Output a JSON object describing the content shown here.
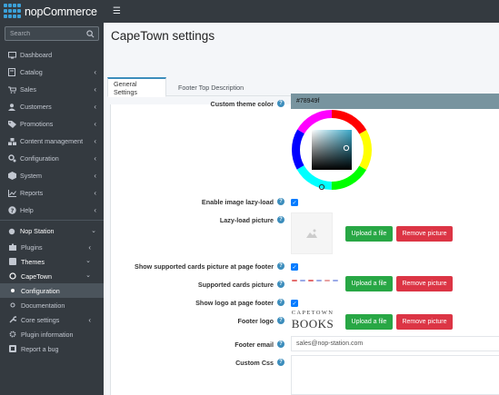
{
  "brand": {
    "name": "nopCommerce"
  },
  "search": {
    "placeholder": "Search"
  },
  "sidebar": {
    "items": [
      {
        "label": "Dashboard",
        "icon": "monitor-icon"
      },
      {
        "label": "Catalog",
        "icon": "book-icon"
      },
      {
        "label": "Sales",
        "icon": "cart-icon"
      },
      {
        "label": "Customers",
        "icon": "user-icon"
      },
      {
        "label": "Promotions",
        "icon": "tag-icon"
      },
      {
        "label": "Content management",
        "icon": "cubes-icon"
      },
      {
        "label": "Configuration",
        "icon": "gears-icon"
      },
      {
        "label": "System",
        "icon": "cube-icon"
      },
      {
        "label": "Reports",
        "icon": "chart-icon"
      },
      {
        "label": "Help",
        "icon": "question-icon"
      }
    ],
    "nop_station": "Nop Station",
    "plugins": "Plugins",
    "themes": "Themes",
    "capetown": "CapeTown",
    "configuration": "Configuration",
    "documentation": "Documentation",
    "core_settings": "Core settings",
    "plugin_information": "Plugin information",
    "report_bug": "Report a bug"
  },
  "page": {
    "title": "CapeTown settings"
  },
  "tabs": [
    {
      "label": "General Settings",
      "active": true
    },
    {
      "label": "Footer Top Description",
      "active": false
    }
  ],
  "form": {
    "custom_theme_color": {
      "label": "Custom theme color",
      "value": "#78949f"
    },
    "enable_lazy_load": {
      "label": "Enable image lazy-load",
      "checked": true
    },
    "lazy_load_picture": {
      "label": "Lazy-load picture"
    },
    "show_cards": {
      "label": "Show supported cards picture at page footer",
      "checked": true
    },
    "supported_cards_picture": {
      "label": "Supported cards picture"
    },
    "show_logo": {
      "label": "Show logo at page footer",
      "checked": true
    },
    "footer_logo": {
      "label": "Footer logo",
      "logo_line1": "CAPETOWN",
      "logo_line2": "BOOKS"
    },
    "footer_email": {
      "label": "Footer email",
      "value": "sales@nop-station.com"
    },
    "custom_css": {
      "label": "Custom Css",
      "value": ""
    },
    "upload_label": "Upload a file",
    "remove_label": "Remove picture"
  },
  "colors": {
    "accent": "#3c8dbc",
    "sidebar_bg": "#343a40",
    "theme_color": "#78949f",
    "upload_green": "#28a745",
    "remove_red": "#dc3545",
    "checkbox_blue": "#007bff"
  }
}
